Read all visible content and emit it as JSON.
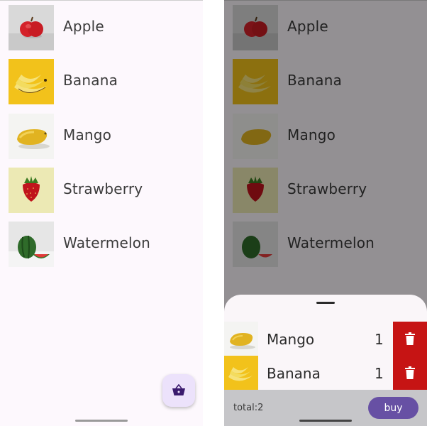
{
  "fruits": [
    {
      "name": "Apple",
      "image": "apple-photo"
    },
    {
      "name": "Banana",
      "image": "banana-photo"
    },
    {
      "name": "Mango",
      "image": "mango-photo"
    },
    {
      "name": "Strawberry",
      "image": "strawberry-photo"
    },
    {
      "name": "Watermelon",
      "image": "watermelon-photo"
    }
  ],
  "fab": {
    "icon": "shopping-basket-icon",
    "background": "#ece2fb",
    "icon_color": "#3a1a6e"
  },
  "cart": {
    "items": [
      {
        "name": "Mango",
        "qty": "1",
        "image": "mango-photo"
      },
      {
        "name": "Banana",
        "qty": "1",
        "image": "banana-photo"
      }
    ],
    "delete_icon": "trash-icon",
    "delete_color": "#c61414",
    "total_label": "total:2",
    "buy_label": "buy",
    "buy_color": "#6750a4"
  }
}
